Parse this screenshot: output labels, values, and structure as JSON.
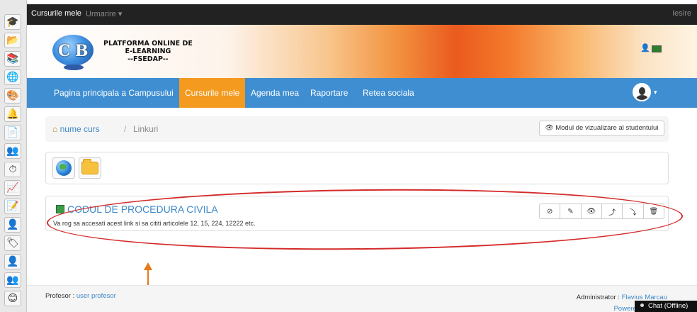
{
  "topbar": {
    "brand": "Cursurile mele",
    "menu": "Urmarire ▾",
    "logout": "Iesire"
  },
  "banner": {
    "title_line1": "PLATFORMA ONLINE DE",
    "title_line2": "E-LEARNING",
    "title_line3": "--FSEDAP--",
    "logo_c": "C",
    "logo_b": "B"
  },
  "nav": {
    "items": [
      {
        "label": "Pagina principala a Campusului"
      },
      {
        "label": "Cursurile mele"
      },
      {
        "label": "Agenda mea"
      },
      {
        "label": "Raportare"
      },
      {
        "label": "Retea sociala"
      }
    ],
    "avatar_caret": "▾"
  },
  "breadcrumb": {
    "home": "nume curs",
    "separator": "/",
    "current": "Linkuri"
  },
  "student_view_button": "👁 Modul de vizualizare al studentului",
  "tools": [
    "globe-icon",
    "folder-icon"
  ],
  "link": {
    "title": "CODUL DE PROCEDURA CIVILA",
    "description": "Va rog sa accesati acest link si sa cititi articolele 12, 15, 224, 12222 etc.",
    "actions": [
      "⊘",
      "✎",
      "👁",
      "⤴",
      "⤵",
      "🗑"
    ]
  },
  "footer": {
    "professor_label": "Profesor :",
    "professor_link": "user profesor",
    "admin_label": "Administrator :",
    "admin_link": "Flavius Marcau",
    "powered": "Powered by Chan"
  },
  "chat": "Chat (Offline)",
  "colors": {
    "nav": "#3f8ed2",
    "active": "#f39a1f",
    "annotation": "#d42a2a",
    "arrow": "#e8781a",
    "link": "#3d88c8"
  }
}
